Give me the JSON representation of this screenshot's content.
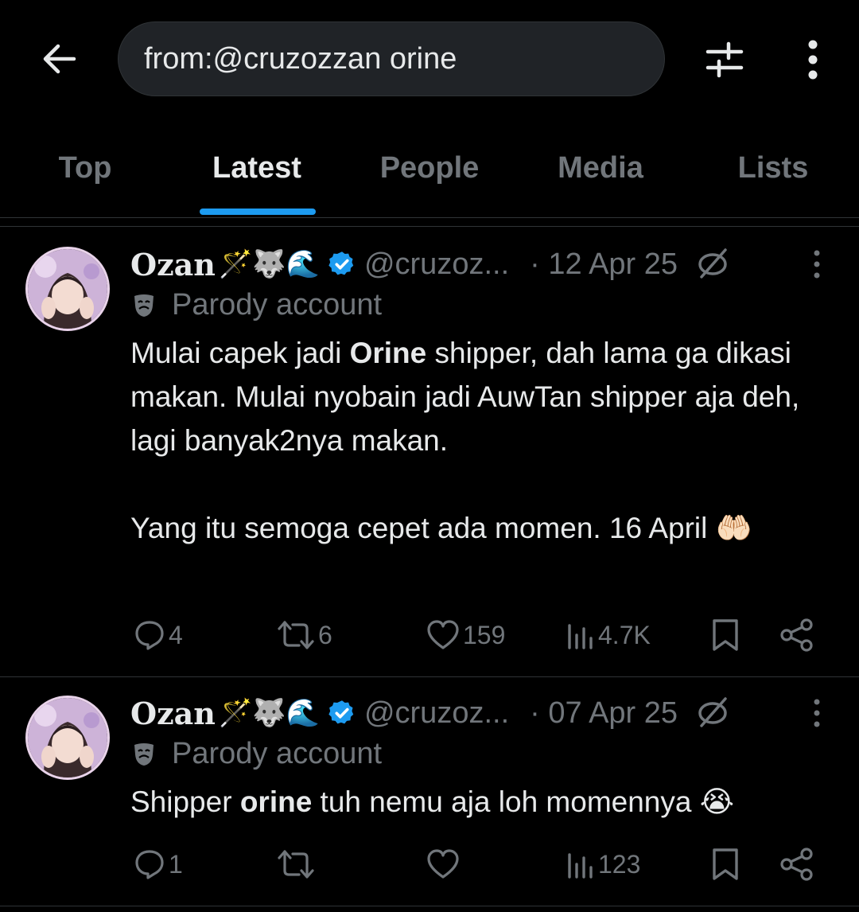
{
  "search": {
    "query": "from:@cruzozzan orine"
  },
  "tabs": [
    {
      "label": "Top"
    },
    {
      "label": "Latest"
    },
    {
      "label": "People"
    },
    {
      "label": "Media"
    },
    {
      "label": "Lists"
    }
  ],
  "active_tab": "Latest",
  "colors": {
    "accent": "#1d9bf0",
    "muted": "#71767b",
    "text": "#e7e9ea",
    "bg": "#000000"
  },
  "tweets": [
    {
      "name": "Ozan",
      "name_emojis": "🪄🐺🌊",
      "handle": "@cruzoz...",
      "date": "· 12 Apr 25",
      "parody_label": "Parody account",
      "body_pre": "Mulai capek jadi ",
      "body_bold": "Orine",
      "body_post": " shipper, dah lama ga dikasi makan. Mulai nyobain jadi AuwTan shipper aja deh, lagi banyak2nya makan.\n\nYang itu semoga cepet ada momen. 16 April 🤲🏻",
      "replies": "4",
      "reposts": "6",
      "likes": "159",
      "views": "4.7K"
    },
    {
      "name": "Ozan",
      "name_emojis": "🪄🐺🌊",
      "handle": "@cruzoz...",
      "date": "· 07 Apr 25",
      "parody_label": "Parody account",
      "body_pre": "Shipper ",
      "body_bold": "orine",
      "body_post": " tuh nemu aja loh momennya 😭",
      "replies": "1",
      "reposts": "",
      "likes": "",
      "views": "123"
    }
  ]
}
